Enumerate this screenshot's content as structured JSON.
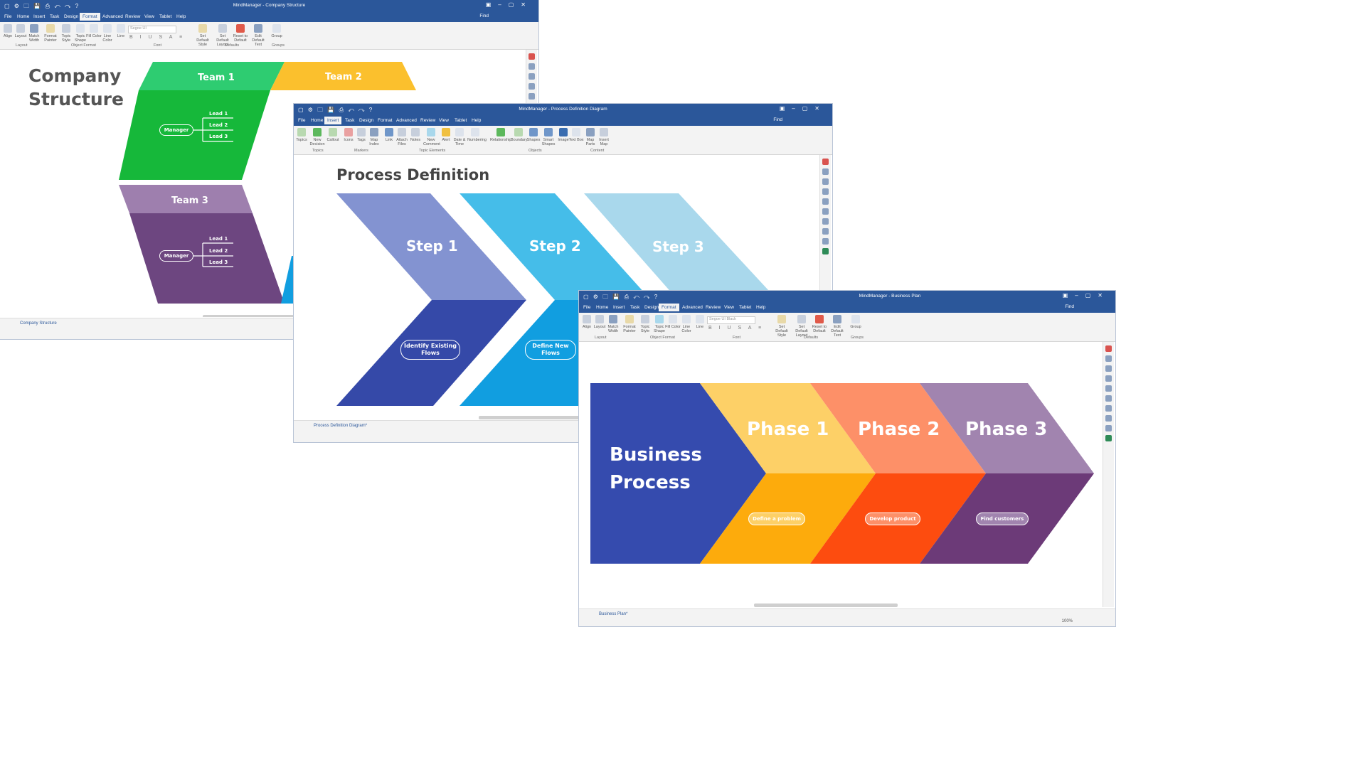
{
  "window1": {
    "title": "MindManager - Company Structure",
    "tabs": [
      "File",
      "Home",
      "Insert",
      "Task",
      "Design",
      "Format",
      "Advanced",
      "Review",
      "View",
      "Tablet",
      "Help"
    ],
    "active_tab": "Format",
    "find_label": "Find",
    "ribbon_buttons": [
      "Align",
      "Layout",
      "Match Width",
      "Format Painter",
      "Topic Style",
      "Topic Shape",
      "Fill Color",
      "Line Color",
      "Line",
      "Set Default Style",
      "Set Default Layout",
      "Reset to Default",
      "Edit Default Text",
      "Group"
    ],
    "ribbon_groups": [
      "Layout",
      "Object Format",
      "Font",
      "Defaults",
      "Groups"
    ],
    "font_box": "Segoe UI",
    "heading_line1": "Company",
    "heading_line2": "Structure",
    "team1": "Team 1",
    "team2": "Team 2",
    "team3": "Team 3",
    "manager": "Manager",
    "lead1": "Lead 1",
    "lead2": "Lead 2",
    "lead3": "Lead 3",
    "doc_tab": "Company Structure"
  },
  "window2": {
    "title": "MindManager - Process Definition Diagram",
    "tabs": [
      "File",
      "Home",
      "Insert",
      "Task",
      "Design",
      "Format",
      "Advanced",
      "Review",
      "View",
      "Tablet",
      "Help"
    ],
    "active_tab": "Insert",
    "find_label": "Find",
    "ribbon_buttons": [
      "Topics",
      "New Decision",
      "Callout",
      "Icons",
      "Tags",
      "Map Index",
      "Link",
      "Attach Files",
      "Notes",
      "Alert",
      "New Comment",
      "Date & Time",
      "Numbering",
      "Relationship",
      "Boundary",
      "Shapes",
      "Smart Shapes",
      "Image",
      "Text Box",
      "Map Parts",
      "Insert Map"
    ],
    "ribbon_groups": [
      "Topics",
      "Markers",
      "Topic Elements",
      "Objects",
      "Content"
    ],
    "heading": "Process Definition",
    "step1": "Step 1",
    "step2": "Step 2",
    "step3": "Step 3",
    "pill1": "Identify Existing Flows",
    "pill2": "Define New Flows",
    "doc_tab": "Process Definition Diagram*"
  },
  "window3": {
    "title": "MindManager - Business Plan",
    "tabs": [
      "File",
      "Home",
      "Insert",
      "Task",
      "Design",
      "Format",
      "Advanced",
      "Review",
      "View",
      "Tablet",
      "Help"
    ],
    "active_tab": "Format",
    "find_label": "Find",
    "ribbon_buttons": [
      "Align",
      "Layout",
      "Match Width",
      "Format Painter",
      "Topic Style",
      "Topic Shape",
      "Fill Color",
      "Line Color",
      "Line",
      "Set Default Style",
      "Set Default Layout",
      "Reset to Default",
      "Edit Default Text",
      "Group"
    ],
    "ribbon_groups": [
      "Layout",
      "Object Format",
      "Font",
      "Defaults",
      "Groups"
    ],
    "font_box": "Segoe UI Black",
    "heading_line1": "Business",
    "heading_line2": "Process",
    "phase1": "Phase 1",
    "phase2": "Phase 2",
    "phase3": "Phase 3",
    "pill1": "Define a problem",
    "pill2": "Develop product",
    "pill3": "Find customers",
    "doc_tab": "Business Plan*",
    "zoom": "100%"
  },
  "colors": {
    "ribbon_blue": "#2b579a",
    "green_light": "#2ecc71",
    "green_dark": "#16b83a",
    "yellow": "#fbc02d",
    "purple_light": "#9e7fae",
    "purple_dark": "#6d4680",
    "periwinkle": "#8393d1",
    "navy": "#3549a8",
    "sky": "#45bde9",
    "sky_dark": "#119ee0",
    "pale_blue": "#a9d8ec",
    "biz_blue": "#354bae",
    "phase1": "#fdd067",
    "phase1_dark": "#fdab0c",
    "phase2": "#fd9068",
    "phase2_dark": "#fd4c0f",
    "phase3": "#a184af",
    "phase3_dark": "#6c3a78"
  }
}
